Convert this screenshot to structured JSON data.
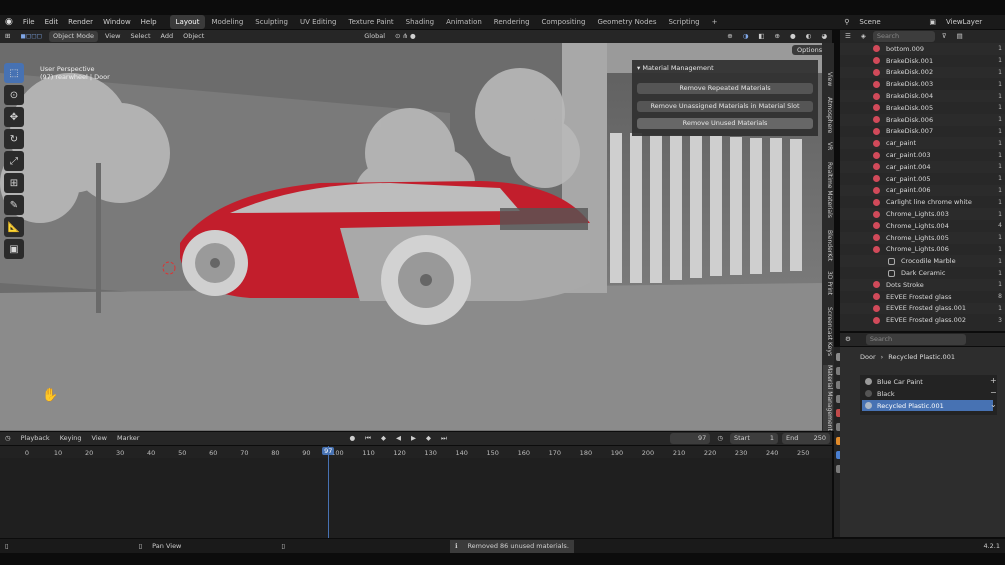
{
  "app": {
    "name": "Blender",
    "version": "4.2.1"
  },
  "menu": [
    "File",
    "Edit",
    "Render",
    "Window",
    "Help"
  ],
  "workspaces": [
    "Layout",
    "Modeling",
    "Sculpting",
    "UV Editing",
    "Texture Paint",
    "Shading",
    "Animation",
    "Rendering",
    "Compositing",
    "Geometry Nodes",
    "Scripting"
  ],
  "active_workspace": "Layout",
  "scene": {
    "label": "Scene",
    "view_layer": "ViewLayer"
  },
  "viewport_header": {
    "mode": "Object Mode",
    "view": "View",
    "select": "Select",
    "add": "Add",
    "object": "Object",
    "orientation": "Global",
    "search_placeholder": "Search",
    "options": "Options"
  },
  "viewport": {
    "info_line1": "User Perspective",
    "info_line2": "(97) rearwheel | Door"
  },
  "panel": {
    "title": "Material Management",
    "buttons": [
      "Remove Repeated Materials",
      "Remove Unassigned Materials in Material Slot",
      "Remove Unused Materials"
    ]
  },
  "side_tabs": [
    "View",
    "Atmosphere",
    "VR",
    "Realtime Materials",
    "BlenderKit",
    "3D Print",
    "Screencast Keys",
    "Material Management"
  ],
  "outliner": {
    "search_placeholder": "Search",
    "items": [
      {
        "name": "bottom.009",
        "users": "1"
      },
      {
        "name": "BrakeDisk.001",
        "users": "1"
      },
      {
        "name": "BrakeDisk.002",
        "users": "1"
      },
      {
        "name": "BrakeDisk.003",
        "users": "1"
      },
      {
        "name": "BrakeDisk.004",
        "users": "1"
      },
      {
        "name": "BrakeDisk.005",
        "users": "1"
      },
      {
        "name": "BrakeDisk.006",
        "users": "1"
      },
      {
        "name": "BrakeDisk.007",
        "users": "1"
      },
      {
        "name": "car_paint",
        "users": "1"
      },
      {
        "name": "car_paint.003",
        "users": "1"
      },
      {
        "name": "car_paint.004",
        "users": "1"
      },
      {
        "name": "car_paint.005",
        "users": "1"
      },
      {
        "name": "car_paint.006",
        "users": "1"
      },
      {
        "name": "Carlight line chrome white",
        "users": "1"
      },
      {
        "name": "Chrome_Lights.003",
        "users": "1"
      },
      {
        "name": "Chrome_Lights.004",
        "users": "4"
      },
      {
        "name": "Chrome_Lights.005",
        "users": "1"
      },
      {
        "name": "Chrome_Lights.006",
        "users": "1"
      },
      {
        "name": "Crocodile Marble",
        "users": "1"
      },
      {
        "name": "Dark Ceramic",
        "users": "1"
      },
      {
        "name": "Dots Stroke",
        "users": "1"
      },
      {
        "name": "EEVEE Frosted glass",
        "users": "8"
      },
      {
        "name": "EEVEE Frosted glass.001",
        "users": "1"
      },
      {
        "name": "EEVEE Frosted glass.002",
        "users": "3"
      }
    ]
  },
  "properties": {
    "breadcrumb": [
      "Door",
      "Recycled Plastic.001"
    ],
    "search_placeholder": "Search",
    "slots": [
      {
        "name": "Blue Car Paint",
        "color": "#9a9a9a"
      },
      {
        "name": "Black",
        "color": "#555555"
      },
      {
        "name": "Recycled Plastic.001",
        "color": "#aab7c7"
      }
    ],
    "selected_slot": 2
  },
  "timeline": {
    "menus": [
      "Playback",
      "Keying",
      "View",
      "Marker"
    ],
    "current_frame": "97",
    "start_label": "Start",
    "start": "1",
    "end_label": "End",
    "end": "250",
    "ticks": [
      "0",
      "10",
      "20",
      "30",
      "40",
      "50",
      "60",
      "70",
      "80",
      "90",
      "100",
      "110",
      "120",
      "130",
      "140",
      "150",
      "160",
      "170",
      "180",
      "190",
      "200",
      "210",
      "220",
      "230",
      "240",
      "250"
    ],
    "playhead_label": "97"
  },
  "status": {
    "pan_view": "Pan View",
    "message": "Removed 86 unused materials.",
    "version": "4.2.1"
  },
  "colors": {
    "car_body": "#c21e2c",
    "accent_blue": "#4772b3",
    "bg": "#262626"
  }
}
